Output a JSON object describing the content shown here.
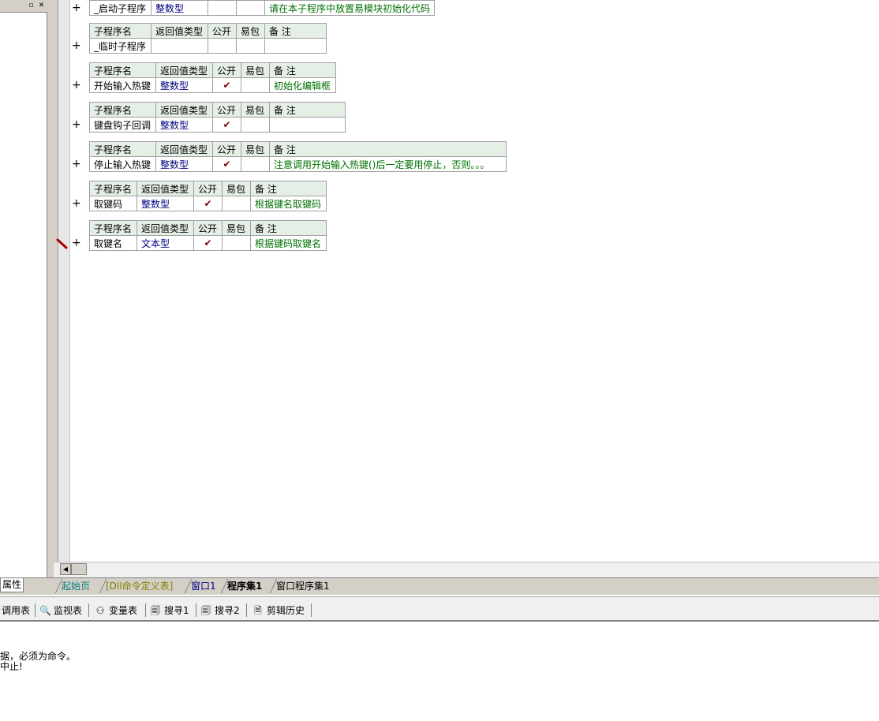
{
  "left_panel": {
    "restore_glyph": "▫",
    "close_glyph": "✕",
    "property_tab": "属性"
  },
  "subprograms": [
    {
      "headers": [
        "子程序名",
        "返回值类型",
        "公开",
        "易包",
        "备 注"
      ],
      "name": "_启动子程序",
      "type": "整数型",
      "public": "",
      "easy": "",
      "note": "请在本子程序中放置易模块初始化代码"
    },
    {
      "headers": [
        "子程序名",
        "返回值类型",
        "公开",
        "易包",
        "备 注"
      ],
      "name": "_临时子程序",
      "type": "",
      "public": "",
      "easy": "",
      "note": ""
    },
    {
      "headers": [
        "子程序名",
        "返回值类型",
        "公开",
        "易包",
        "备 注"
      ],
      "name": "开始输入热键",
      "type": "整数型",
      "public": "✔",
      "easy": "",
      "note": "初始化编辑框"
    },
    {
      "headers": [
        "子程序名",
        "返回值类型",
        "公开",
        "易包",
        "备 注"
      ],
      "name": "键盘钩子回调",
      "type": "整数型",
      "public": "✔",
      "easy": "",
      "note": ""
    },
    {
      "headers": [
        "子程序名",
        "返回值类型",
        "公开",
        "易包",
        "备 注"
      ],
      "name": "停止输入热键",
      "type": "整数型",
      "public": "✔",
      "easy": "",
      "note": "注意调用开始输入热键()后一定要用停止，否则。。。"
    },
    {
      "headers": [
        "子程序名",
        "返回值类型",
        "公开",
        "易包",
        "备 注"
      ],
      "name": "取键码",
      "type": "整数型",
      "public": "✔",
      "easy": "",
      "note": "根据键名取键码"
    },
    {
      "headers": [
        "子程序名",
        "返回值类型",
        "公开",
        "易包",
        "备 注"
      ],
      "name": "取键名",
      "type": "文本型",
      "public": "✔",
      "easy": "",
      "note": "根据键码取键名"
    }
  ],
  "plus_glyph": "+",
  "tabs": [
    {
      "label": "起始页",
      "color": "#008080"
    },
    {
      "label": "[Dll命令定义表]",
      "color": "#808000"
    },
    {
      "label": "窗口1",
      "color": "#000080"
    },
    {
      "label": "程序集1",
      "color": "#000000",
      "active": true
    },
    {
      "label": "窗口程序集1",
      "color": "#000000"
    }
  ],
  "toolbar": {
    "items": [
      {
        "label": "调用表",
        "icon": ""
      },
      {
        "label": "监视表",
        "icon": "🔍"
      },
      {
        "label": "变量表",
        "icon": "⚇"
      },
      {
        "label": "搜寻1",
        "icon": "🗐"
      },
      {
        "label": "搜寻2",
        "icon": "🗐"
      },
      {
        "label": "剪辑历史",
        "icon": "🗎"
      }
    ]
  },
  "output": {
    "lines": [
      "据，必须为命令。",
      "中止!"
    ]
  },
  "colors": {
    "header_bg": "#e6efe6",
    "type_text": "#000080",
    "note_text": "#007000",
    "check": "#800000"
  }
}
